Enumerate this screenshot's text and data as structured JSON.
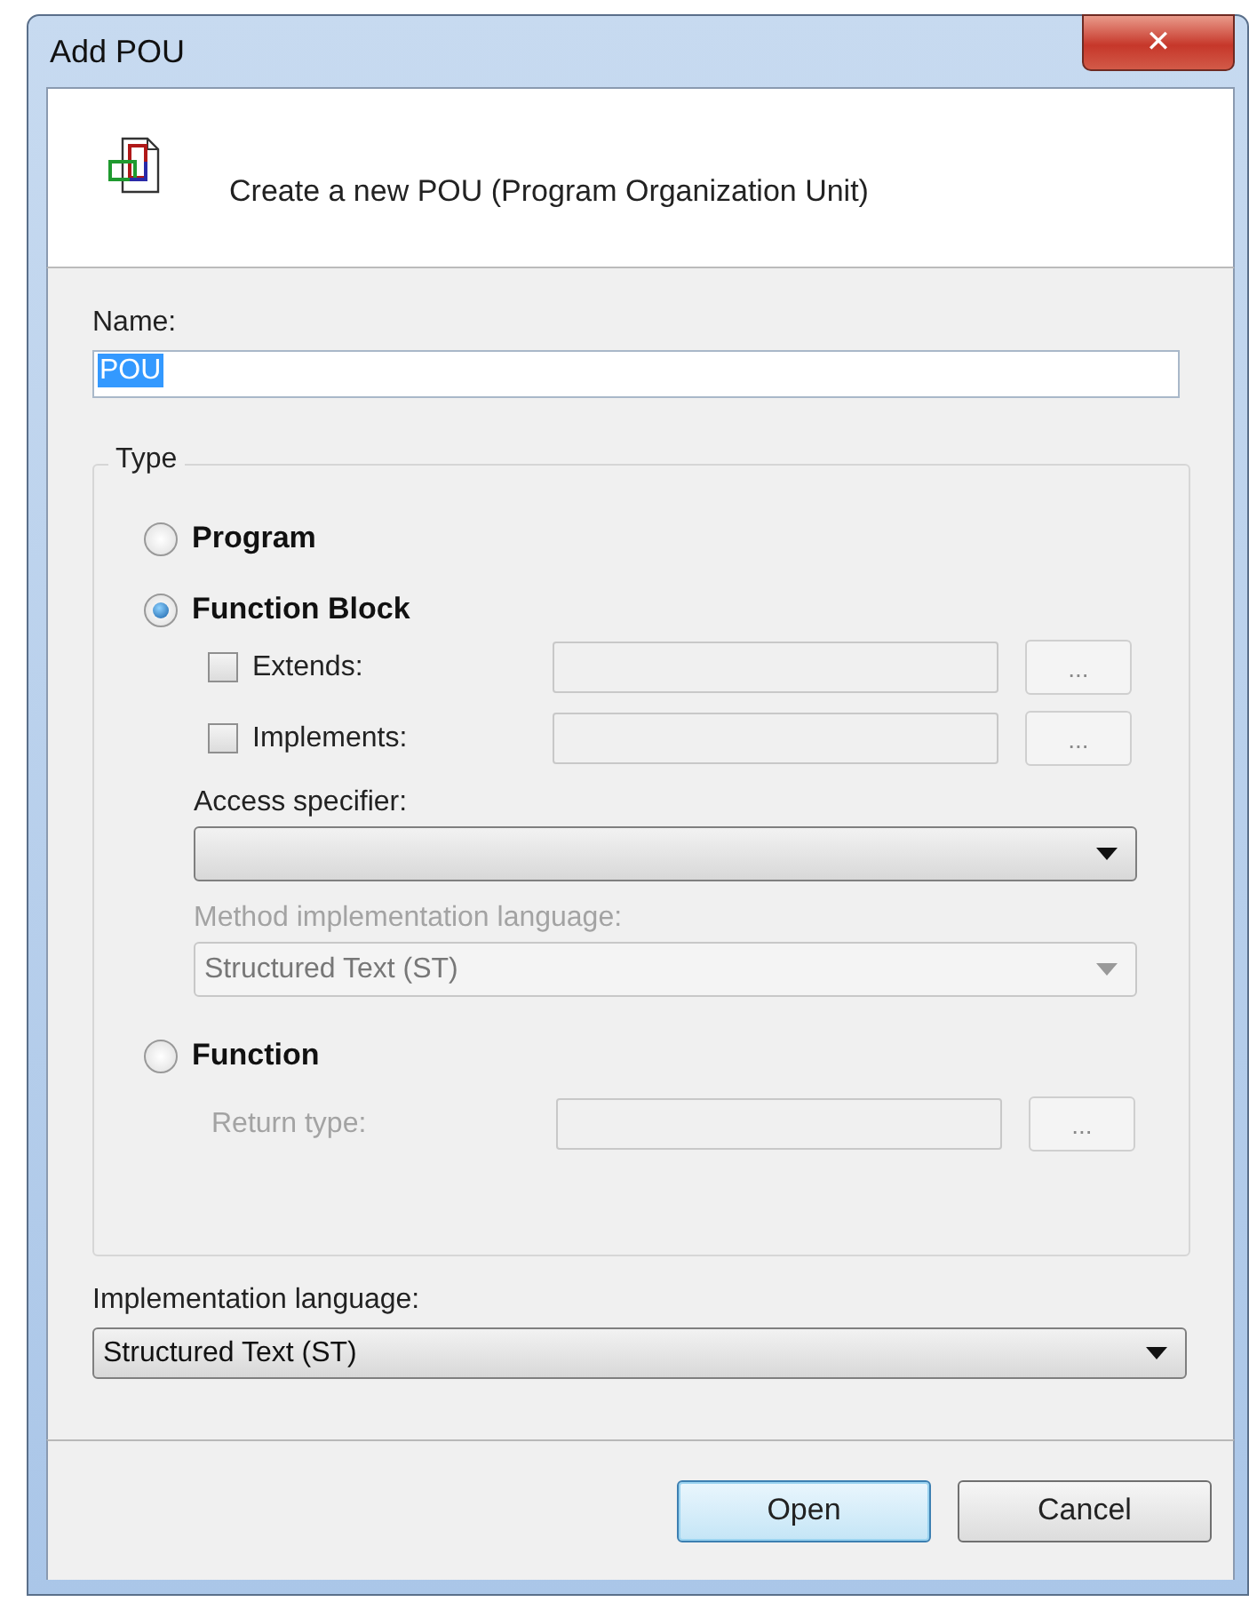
{
  "window": {
    "title": "Add POU",
    "close": "✕"
  },
  "header": {
    "text": "Create a new POU (Program Organization Unit)"
  },
  "name_field": {
    "label": "Name:",
    "value": "POU"
  },
  "type_group": {
    "title": "Type",
    "options": [
      {
        "label": "Program",
        "selected": false
      },
      {
        "label": "Function Block",
        "selected": true,
        "checkboxes": [
          {
            "label": "Extends:",
            "checked": false,
            "browse": "..."
          },
          {
            "label": "Implements:",
            "checked": false,
            "browse": "..."
          }
        ],
        "access_specifier": {
          "label": "Access specifier:",
          "disabled": false
        },
        "method_language": {
          "label": "Method implementation language:",
          "value": "Structured Text (ST)",
          "disabled": true
        }
      },
      {
        "label": "Function",
        "selected": false,
        "return_type": {
          "label": "Return type:",
          "disabled": true,
          "browse": "..."
        }
      }
    ]
  },
  "implementation_language": {
    "label": "Implementation language:",
    "value": "Structured Text (ST)"
  },
  "buttons": [
    {
      "label": "Open",
      "default": true
    },
    {
      "label": "Cancel",
      "default": false
    }
  ]
}
